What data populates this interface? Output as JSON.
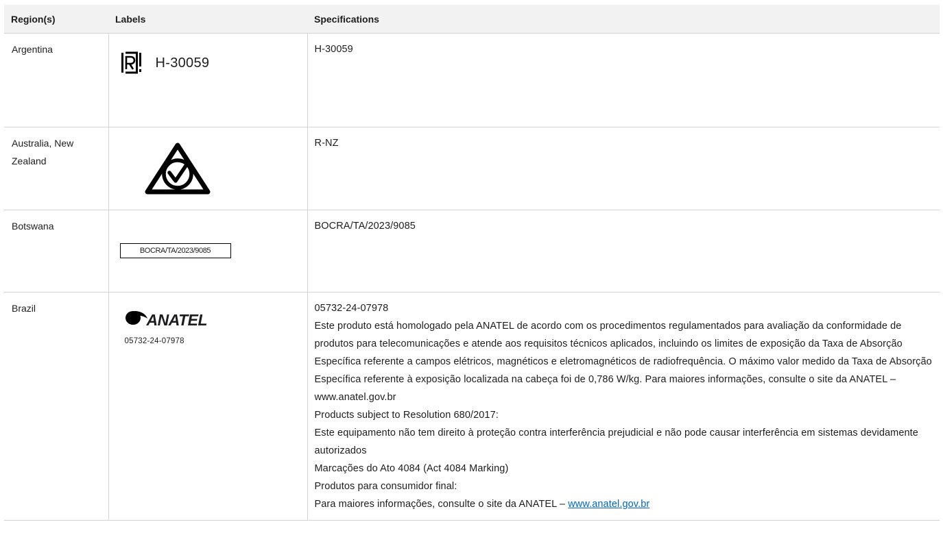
{
  "table": {
    "headers": [
      "Region(s)",
      "Labels",
      "Specifications"
    ],
    "rows": [
      {
        "region": "Argentina",
        "label": {
          "icon": "argentina-registration-icon",
          "code": "H-30059"
        },
        "spec_lines": [
          "H-30059"
        ]
      },
      {
        "region": "Australia, New Zealand",
        "label": {
          "icon": "rcm-compliance-mark-icon"
        },
        "spec_lines": [
          "R-NZ"
        ]
      },
      {
        "region": "Botswana",
        "label": {
          "box_text": "BOCRA/TA/2023/9085"
        },
        "spec_lines": [
          "BOCRA/TA/2023/9085"
        ]
      },
      {
        "region": "Brazil",
        "label": {
          "icon": "anatel-logo-icon",
          "word": "ANATEL",
          "code": "05732-24-07978"
        },
        "spec_lines": [
          "05732-24-07978",
          "Este produto está homologado pela ANATEL de acordo com os procedimentos regulamentados para avaliação da conformidade de produtos para telecomunicações e atende aos requisitos técnicos aplicados, incluindo os limites de exposição da Taxa de Absorção Específica referente a campos elétricos, magnéticos e eletromagnéticos de radiofrequência. O máximo valor medido da Taxa de Absorção Específica referente à exposição localizada na cabeça foi de 0,786 W/kg. Para maiores informações, consulte o site da ANATEL – www.anatel.gov.br",
          "Products subject to Resolution 680/2017:",
          "Este equipamento não tem direito à proteção contra interferência prejudicial e não pode causar interferência em sistemas devidamente autorizados",
          "Marcações do Ato 4084 (Act 4084 Marking)",
          "Produtos para consumidor final:"
        ],
        "spec_last_prefix": "Para maiores informações, consulte o site da ANATEL – ",
        "spec_last_link": "www.anatel.gov.br"
      }
    ]
  },
  "colors": {
    "header_bg": "#f2f2f2",
    "border": "#d2d2d7",
    "link": "#0066cc",
    "text": "#1d1d1f"
  }
}
